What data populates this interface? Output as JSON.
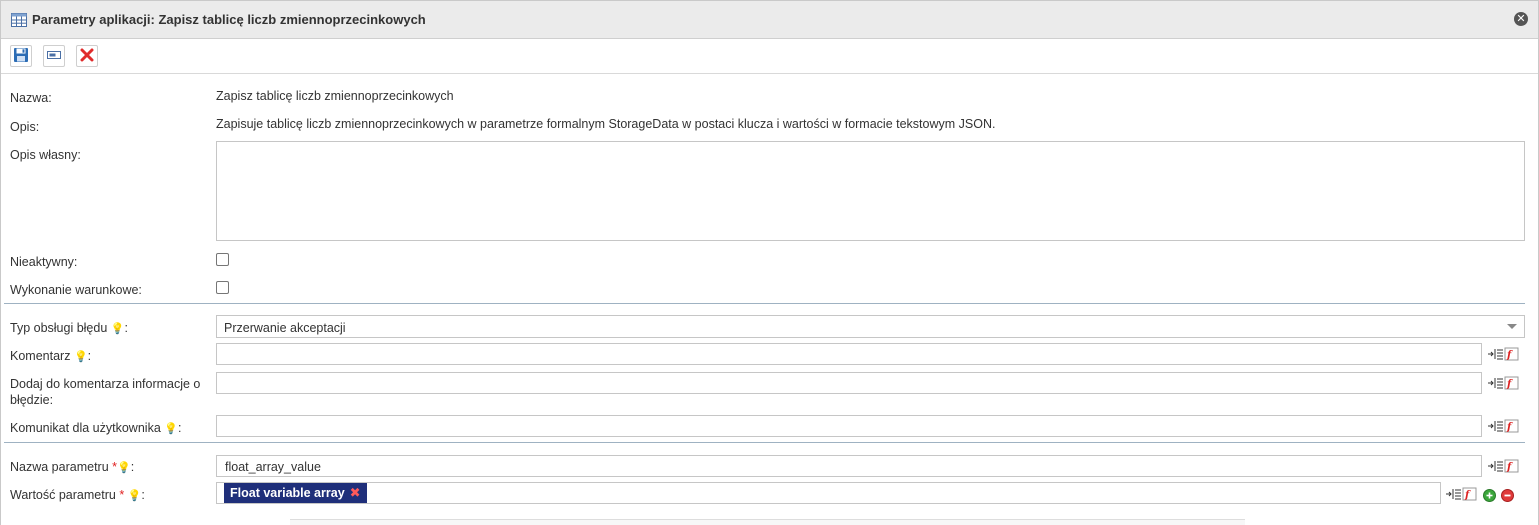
{
  "dialog": {
    "title": "Parametry aplikacji: Zapisz tablicę liczb zmiennoprzecinkowych",
    "close_symbol": "✕"
  },
  "toolbar": {
    "buttons": [
      "save-icon",
      "form-icon",
      "delete-icon"
    ]
  },
  "form": {
    "name_label": "Nazwa:",
    "name_value": "Zapisz tablicę liczb zmiennoprzecinkowych",
    "desc_label": "Opis:",
    "desc_value": "Zapisuje tablicę liczb zmiennoprzecinkowych w parametrze formalnym StorageData w postaci klucza i wartości w formacie tekstowym JSON.",
    "custom_desc_label": "Opis własny:",
    "custom_desc_value": "",
    "inactive_label": "Nieaktywny:",
    "inactive_checked": false,
    "conditional_label": "Wykonanie warunkowe:",
    "conditional_checked": false,
    "error_type_label": "Typ obsługi błędu",
    "error_type_value": "Przerwanie akceptacji",
    "comment_label": "Komentarz",
    "comment_value": "",
    "add_error_info_label_1": "Dodaj do komentarza informacje o",
    "add_error_info_label_2": "błędzie:",
    "add_error_info_value": "",
    "user_message_label": "Komunikat dla użytkownika",
    "user_message_value": "",
    "param_name_label": "Nazwa parametru",
    "param_name_value": "float_array_value",
    "param_value_label": "Wartość parametru",
    "param_value_tag": "Float variable array",
    "colon": ":",
    "required_mark": "*"
  },
  "colors": {
    "tag_bg": "#1f2f7a",
    "required": "#e02020",
    "separator": "#9fb2c2"
  }
}
